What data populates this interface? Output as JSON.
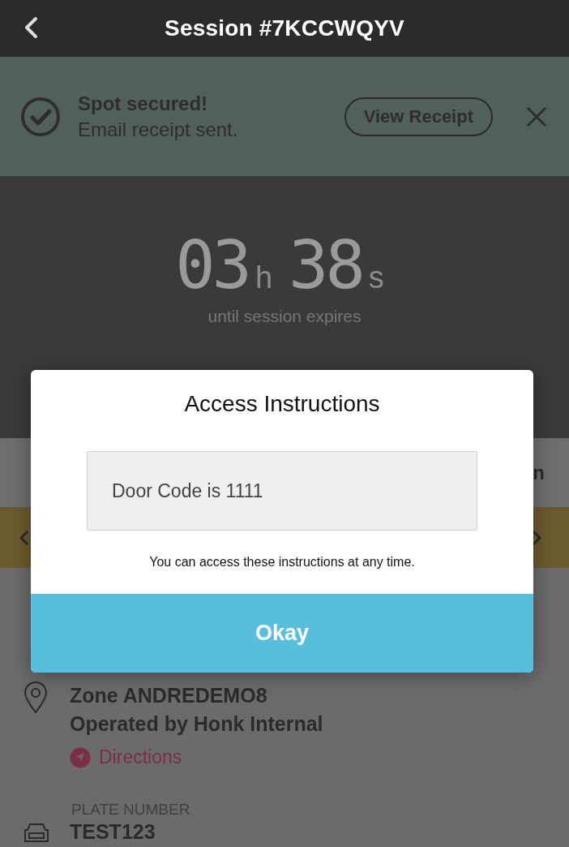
{
  "header": {
    "title": "Session #7KCCWQYV"
  },
  "banner": {
    "title": "Spot secured!",
    "message": "Email receipt sent.",
    "button": "View Receipt"
  },
  "timer": {
    "hours": "03",
    "hours_unit": "h",
    "seconds": "38",
    "seconds_unit": "s",
    "caption": "until session expires"
  },
  "action_row": {
    "label_fragment": "n"
  },
  "location": {
    "zone": "Zone ANDREDEMO8",
    "operator": "Operated by Honk Internal",
    "directions": "Directions"
  },
  "plate": {
    "label": "PLATE NUMBER",
    "value": "TEST123"
  },
  "dialog": {
    "title": "Access Instructions",
    "instructions": "Door Code is 1111",
    "note": "You can access these instructions at any time.",
    "button": "Okay"
  }
}
